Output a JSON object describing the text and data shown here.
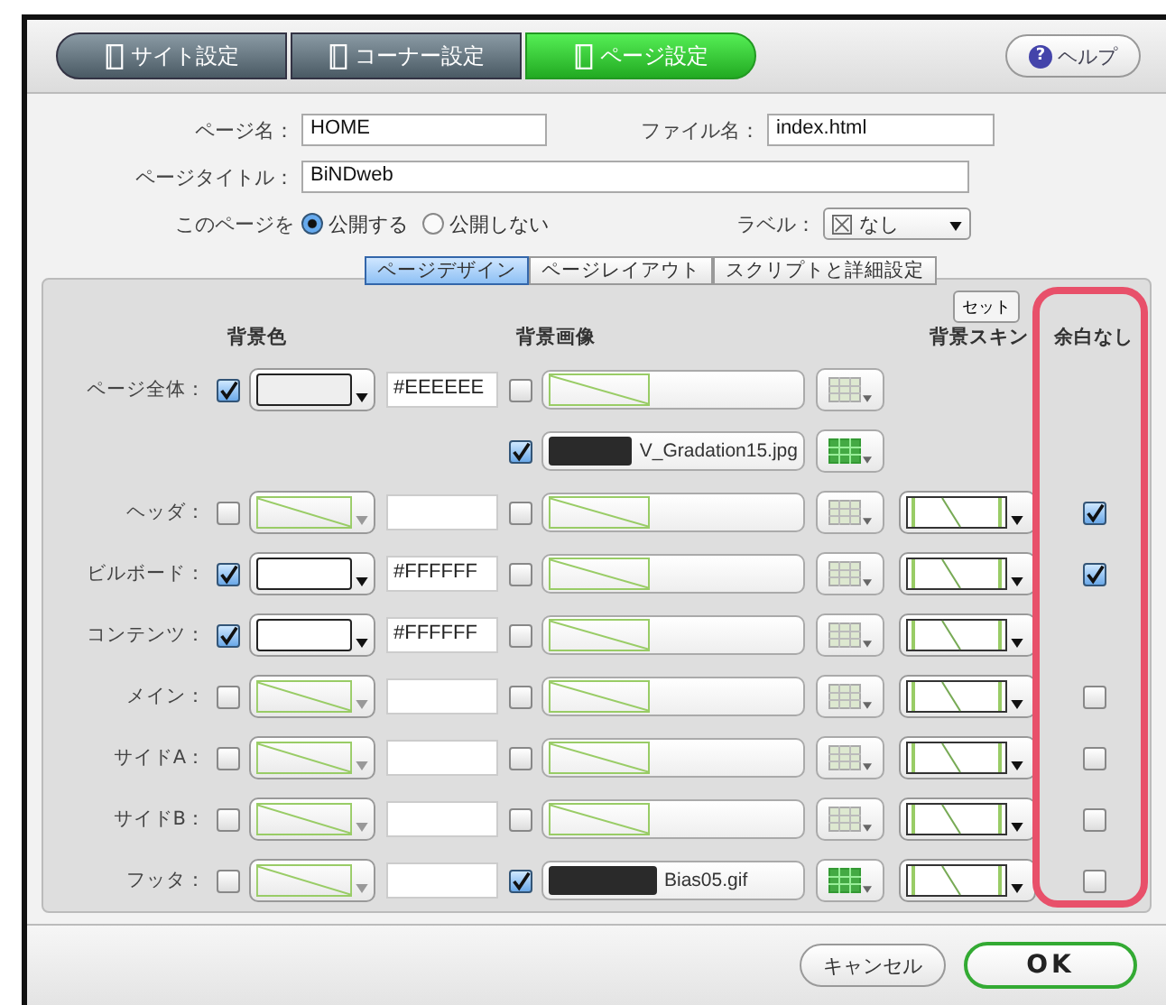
{
  "top_tabs": [
    {
      "label": "サイト設定",
      "selected": false
    },
    {
      "label": "コーナー設定",
      "selected": false
    },
    {
      "label": "ページ設定",
      "selected": true
    }
  ],
  "help_icon": "?",
  "help_button": "ヘルプ",
  "form": {
    "page_name_label": "ページ名：",
    "page_name": "HOME",
    "file_name_label": "ファイル名：",
    "file_name": "index.html",
    "page_title_label": "ページタイトル：",
    "page_title": "BiNDweb",
    "publish_label": "このページを",
    "publish_options": [
      {
        "label": "公開する",
        "selected": true
      },
      {
        "label": "公開しない",
        "selected": false
      }
    ],
    "label_label": "ラベル：",
    "label_value": "なし"
  },
  "sub_tabs": [
    {
      "label": "ページデザイン",
      "selected": true
    },
    {
      "label": "ページレイアウト",
      "selected": false
    },
    {
      "label": "スクリプトと詳細設定",
      "selected": false
    }
  ],
  "set_button": "セット",
  "columns": {
    "bg_color": "背景色",
    "bg_image": "背景画像",
    "bg_skin": "背景スキン",
    "no_margin": "余白なし"
  },
  "rows": [
    {
      "label": "ページ全体：",
      "color": {
        "checked": true,
        "kind": "swatch",
        "color": "#eeeeee",
        "hex": "#EEEEEE"
      },
      "images": [
        {
          "checked": false,
          "kind": "empty",
          "grid_active": false
        },
        {
          "checked": true,
          "kind": "file",
          "filename": "V_Gradation15.jpg",
          "grid_active": true
        }
      ],
      "skin": false
    },
    {
      "label": "ヘッダ：",
      "color": {
        "checked": false,
        "kind": "none"
      },
      "images": [
        {
          "checked": false,
          "kind": "empty",
          "grid_active": false
        }
      ],
      "skin": true,
      "no_margin": {
        "checked": true
      }
    },
    {
      "label": "ビルボード：",
      "color": {
        "checked": true,
        "kind": "swatch",
        "color": "#ffffff",
        "hex": "#FFFFFF"
      },
      "images": [
        {
          "checked": false,
          "kind": "empty",
          "grid_active": false
        }
      ],
      "skin": true,
      "no_margin": {
        "checked": true
      }
    },
    {
      "label": "コンテンツ：",
      "color": {
        "checked": true,
        "kind": "swatch",
        "color": "#ffffff",
        "hex": "#FFFFFF"
      },
      "images": [
        {
          "checked": false,
          "kind": "empty",
          "grid_active": false
        }
      ],
      "skin": true
    },
    {
      "label": "メイン：",
      "color": {
        "checked": false,
        "kind": "none"
      },
      "images": [
        {
          "checked": false,
          "kind": "empty",
          "grid_active": false
        }
      ],
      "skin": true,
      "no_margin": {
        "checked": false
      }
    },
    {
      "label": "サイドA：",
      "color": {
        "checked": false,
        "kind": "none"
      },
      "images": [
        {
          "checked": false,
          "kind": "empty",
          "grid_active": false
        }
      ],
      "skin": true,
      "no_margin": {
        "checked": false
      }
    },
    {
      "label": "サイドB：",
      "color": {
        "checked": false,
        "kind": "none"
      },
      "images": [
        {
          "checked": false,
          "kind": "empty",
          "grid_active": false
        }
      ],
      "skin": true,
      "no_margin": {
        "checked": false
      }
    },
    {
      "label": "フッタ：",
      "color": {
        "checked": false,
        "kind": "none"
      },
      "images": [
        {
          "checked": true,
          "kind": "file",
          "filename": "Bias05.gif",
          "grid_active": true
        }
      ],
      "skin": true,
      "no_margin": {
        "checked": false
      }
    }
  ],
  "buttons": {
    "cancel": "キャンセル",
    "ok": "OK"
  }
}
